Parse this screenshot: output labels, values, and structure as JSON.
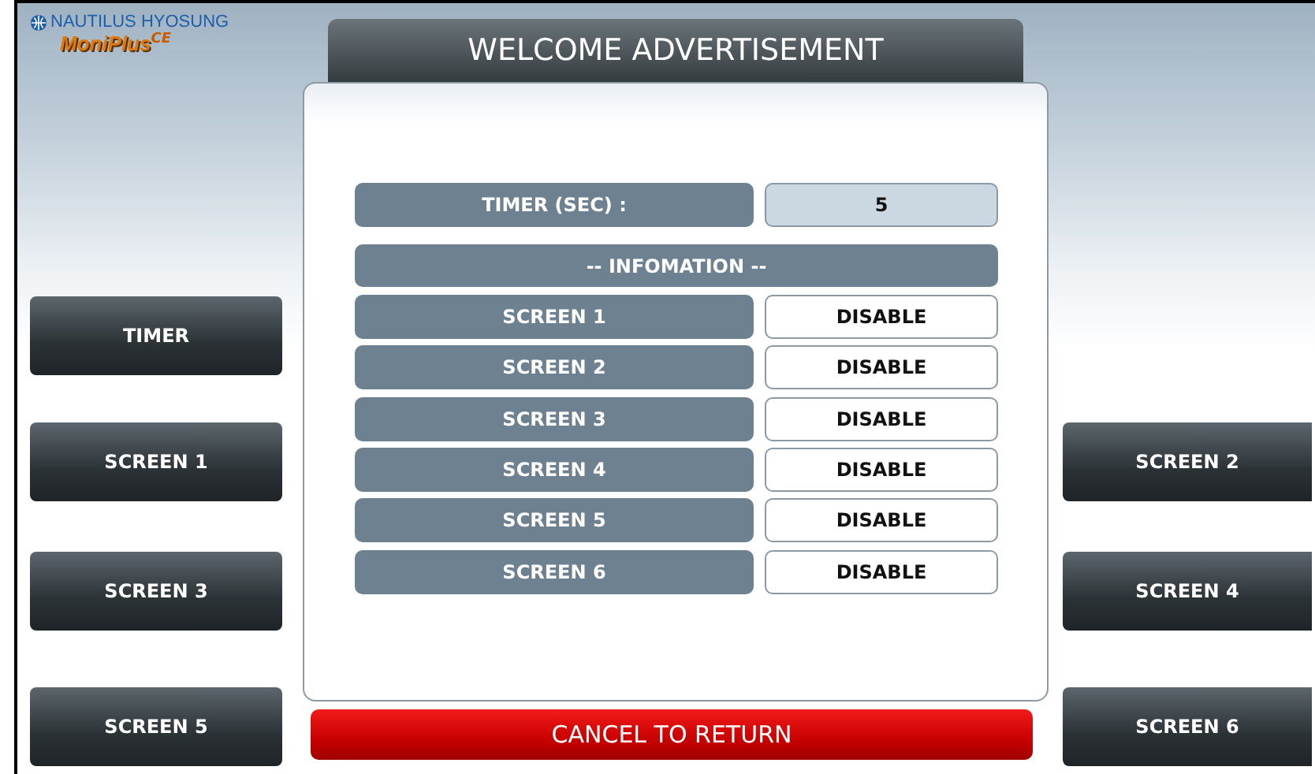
{
  "logo": {
    "company": "NAUTILUS HYOSUNG",
    "product": "MoniPlus",
    "edition": "CE"
  },
  "title": "WELCOME ADVERTISEMENT",
  "timer": {
    "label": "TIMER (SEC) :",
    "value": "5"
  },
  "info_header": "-- INFOMATION --",
  "screens": [
    {
      "label": "SCREEN 1",
      "value": "DISABLE"
    },
    {
      "label": "SCREEN 2",
      "value": "DISABLE"
    },
    {
      "label": "SCREEN 3",
      "value": "DISABLE"
    },
    {
      "label": "SCREEN 4",
      "value": "DISABLE"
    },
    {
      "label": "SCREEN 5",
      "value": "DISABLE"
    },
    {
      "label": "SCREEN 6",
      "value": "DISABLE"
    }
  ],
  "left_buttons": [
    "TIMER",
    "SCREEN 1",
    "SCREEN 3",
    "SCREEN 5"
  ],
  "right_buttons": [
    "SCREEN 2",
    "SCREEN 4",
    "SCREEN 6"
  ],
  "cancel_button": "CANCEL TO RETURN"
}
